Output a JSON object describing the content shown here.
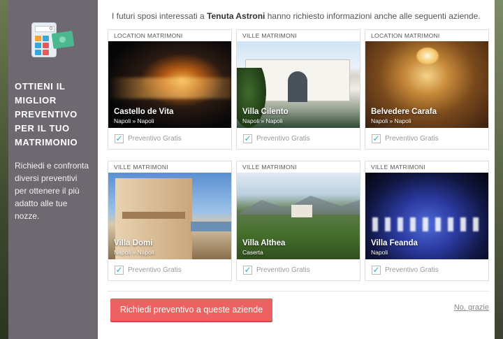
{
  "sidebar": {
    "calculator_display": "0",
    "headline": "OTTIENI IL MIGLIOR PREVENTIVO PER IL TUO MATRIMONIO",
    "description": "Richiedi e confronta diversi preventivi per ottenere il più adatto alle tue nozze.",
    "icon": "calculator-money-icon"
  },
  "intro": {
    "prefix": "I futuri sposi interessati a ",
    "venue": "Tenuta Astroni",
    "suffix": " hanno richiesto informazioni anche alle seguenti aziende."
  },
  "cards": [
    {
      "category": "LOCATION MATRIMONI",
      "name": "Castello de Vita",
      "location": "Napoli » Napoli",
      "checkbox_label": "Preventivo Gratis",
      "checked": true
    },
    {
      "category": "VILLE MATRIMONI",
      "name": "Villa Cilento",
      "location": "Napoli » Napoli",
      "checkbox_label": "Preventivo Gratis",
      "checked": true
    },
    {
      "category": "LOCATION MATRIMONI",
      "name": "Belvedere Carafa",
      "location": "Napoli » Napoli",
      "checkbox_label": "Preventivo Gratis",
      "checked": true
    },
    {
      "category": "VILLE MATRIMONI",
      "name": "Villa Domi",
      "location": "Napoli » Napoli",
      "checkbox_label": "Preventivo Gratis",
      "checked": true
    },
    {
      "category": "VILLE MATRIMONI",
      "name": "Villa Althea",
      "location": "Caserta",
      "checkbox_label": "Preventivo Gratis",
      "checked": true
    },
    {
      "category": "VILLE MATRIMONI",
      "name": "Villa Feanda",
      "location": "Napoli",
      "checkbox_label": "Preventivo Gratis",
      "checked": true
    }
  ],
  "footer": {
    "cta_label": "Richiedi preventivo a queste aziende",
    "dismiss_label": "No, grazie"
  },
  "colors": {
    "sidebar_bg": "#6e6870",
    "cta_bg": "#ec6161",
    "check_color": "#27a9c7"
  }
}
